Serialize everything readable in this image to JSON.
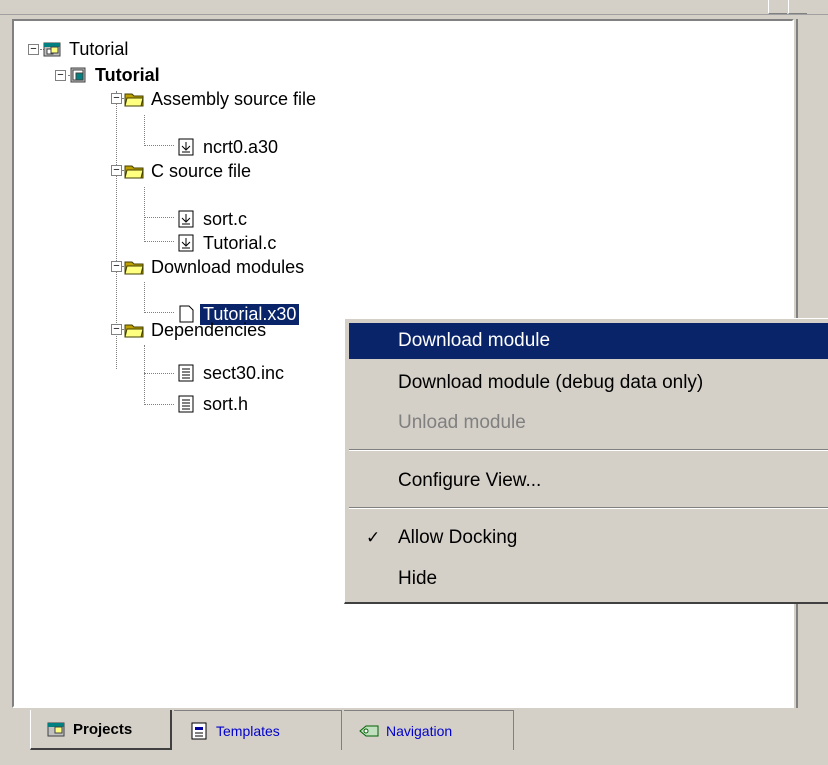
{
  "tree": {
    "nodes": [
      {
        "label": "Tutorial",
        "icon": "workspace-icon"
      },
      {
        "label": "Tutorial",
        "icon": "project-icon"
      },
      {
        "label": "Assembly source file",
        "icon": "folder-icon"
      },
      {
        "label": "ncrt0.a30",
        "icon": "source-file-icon"
      },
      {
        "label": "C source file",
        "icon": "folder-icon"
      },
      {
        "label": "sort.c",
        "icon": "source-file-icon"
      },
      {
        "label": "Tutorial.c",
        "icon": "source-file-icon"
      },
      {
        "label": "Download modules",
        "icon": "folder-icon"
      },
      {
        "label": "Tutorial.x30",
        "icon": "blank-file-icon"
      },
      {
        "label": "Dependencies",
        "icon": "folder-icon"
      },
      {
        "label": "sect30.inc",
        "icon": "text-file-icon"
      },
      {
        "label": "sort.h",
        "icon": "text-file-icon"
      }
    ]
  },
  "context_menu": {
    "items": [
      {
        "label": "Download module"
      },
      {
        "label": "Download module (debug data only)"
      },
      {
        "label": "Unload module"
      },
      {
        "label": "Configure View..."
      },
      {
        "label": "Allow Docking",
        "check": "✓"
      },
      {
        "label": "Hide"
      }
    ]
  },
  "tabs": [
    {
      "label": "Projects"
    },
    {
      "label": "Templates"
    },
    {
      "label": "Navigation"
    }
  ],
  "colors": {
    "selection": "#0a246a",
    "panel": "#d4d0c8",
    "tab_link": "#0000cc"
  }
}
